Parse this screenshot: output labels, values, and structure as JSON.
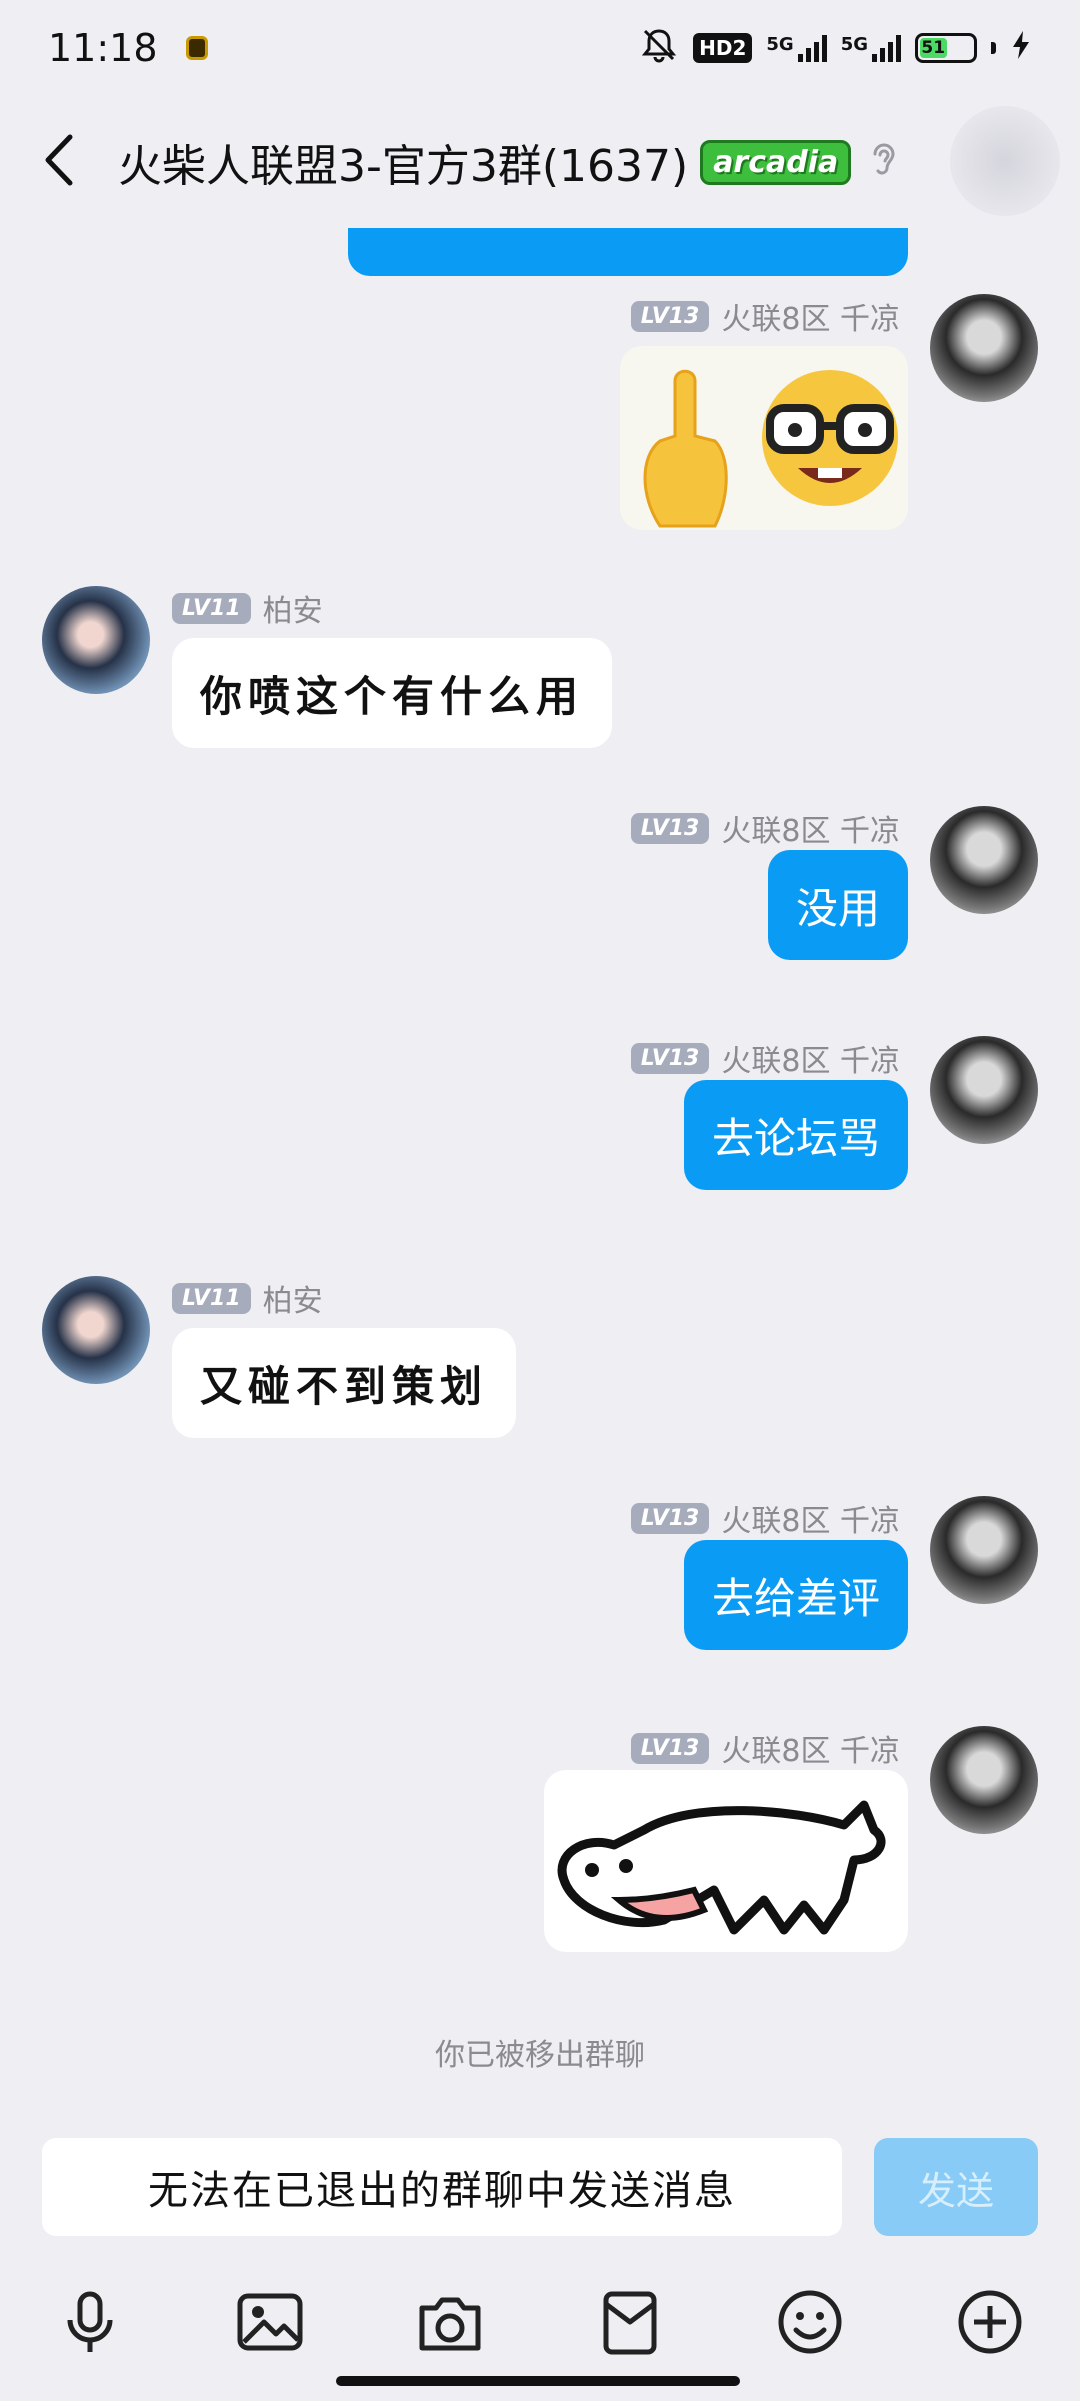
{
  "status_bar": {
    "time": "11:18",
    "hd_label": "HD2",
    "network1": "5G",
    "network2": "5G",
    "battery": "51"
  },
  "header": {
    "title": "火柴人联盟3-官方3群(1637)",
    "badge": "arcadia"
  },
  "messages": [
    {
      "side": "me",
      "level": "LV13",
      "name": "火联8区 千凉",
      "type": "image",
      "image_desc": "finger-pointing-and-nerd-emoji"
    },
    {
      "side": "other",
      "level": "LV11",
      "name": "柏安",
      "type": "text",
      "text": "你喷这个有什么用"
    },
    {
      "side": "me",
      "level": "LV13",
      "name": "火联8区 千凉",
      "type": "text",
      "text": "没用"
    },
    {
      "side": "me",
      "level": "LV13",
      "name": "火联8区 千凉",
      "type": "text",
      "text": "去论坛骂"
    },
    {
      "side": "other",
      "level": "LV11",
      "name": "柏安",
      "type": "text",
      "text": "又碰不到策划"
    },
    {
      "side": "me",
      "level": "LV13",
      "name": "火联8区 千凉",
      "type": "text",
      "text": "去给差评"
    },
    {
      "side": "me",
      "level": "LV13",
      "name": "火联8区 千凉",
      "type": "image",
      "image_desc": "cat-doodle-sticker"
    }
  ],
  "system_note": "你已被移出群聊",
  "input": {
    "placeholder": "无法在已退出的群聊中发送消息",
    "send_label": "发送"
  },
  "toolbar_icons": [
    "microphone-icon",
    "image-icon",
    "camera-icon",
    "red-packet-icon",
    "emoji-icon",
    "plus-icon"
  ],
  "colors": {
    "accent": "#0A9BF5",
    "send_disabled": "#87CBF6",
    "background": "#EEEEF3"
  }
}
